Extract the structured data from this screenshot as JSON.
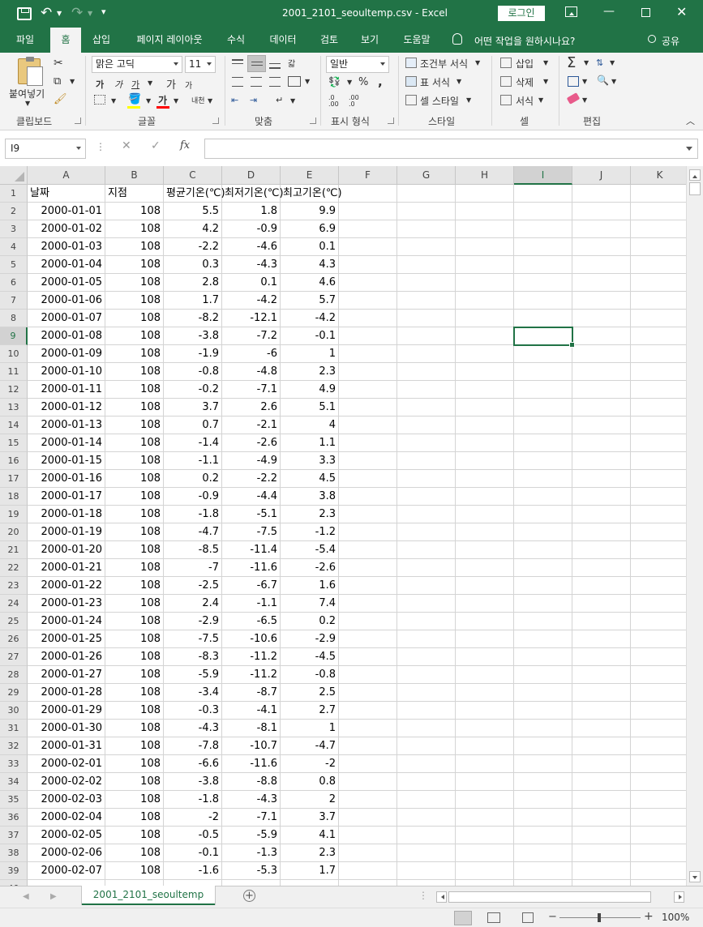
{
  "title_bar": {
    "document_title": "2001_2101_seoultemp.csv  -  Excel",
    "login_label": "로그인",
    "colors": {
      "brand": "#217346",
      "selection": "#217346"
    }
  },
  "quick_access": {
    "save_icon": "save-icon",
    "undo_icon": "undo-icon",
    "redo_icon": "redo-icon",
    "customize": "▾"
  },
  "tabs": [
    {
      "label": "파일"
    },
    {
      "label": "홈",
      "active": true
    },
    {
      "label": "삽입"
    },
    {
      "label": "페이지 레이아웃"
    },
    {
      "label": "수식"
    },
    {
      "label": "데이터"
    },
    {
      "label": "검토"
    },
    {
      "label": "보기"
    },
    {
      "label": "도움말"
    }
  ],
  "tell_me": "어떤 작업을 원하시나요?",
  "share": "공유",
  "ribbon": {
    "clipboard": {
      "paste_label": "붙여넣기",
      "group_label": "클립보드"
    },
    "font": {
      "font_name": "맑은 고딕",
      "font_size": "11",
      "group_label": "글꼴",
      "grow": "가",
      "shrink": "가",
      "bold": "가",
      "italic": "가",
      "underline": "가",
      "font_color_glyph": "가",
      "phonetic": "내천"
    },
    "alignment": {
      "group_label": "맞춤",
      "wrap": "갋"
    },
    "number": {
      "format": "일반",
      "group_label": "표시 형식",
      "percent": "%",
      "comma": ",",
      "inc_dec": ".0 .00",
      "dec_dec": ".00 .0"
    },
    "styles": {
      "conditional": "조건부 서식",
      "table": "표 서식",
      "cell_styles": "셀 스타일",
      "group_label": "스타일"
    },
    "cells": {
      "insert": "삽입",
      "delete": "삭제",
      "format": "서식",
      "group_label": "셀"
    },
    "editing": {
      "autosum": "Σ",
      "group_label": "편집"
    }
  },
  "formula_bar": {
    "name_box": "I9",
    "formula": "",
    "fx": "fx",
    "cancel": "✕",
    "enter": "✓"
  },
  "columns": [
    "A",
    "B",
    "C",
    "D",
    "E",
    "F",
    "G",
    "H",
    "I",
    "J",
    "K"
  ],
  "selected_cell": {
    "col": "I",
    "row": 9
  },
  "sheet": {
    "header": [
      "날짜",
      "지점",
      "평균기온(℃)",
      "최저기온(℃)",
      "최고기온(℃)"
    ],
    "rows": [
      [
        "2000-01-01",
        "108",
        "5.5",
        "1.8",
        "9.9"
      ],
      [
        "2000-01-02",
        "108",
        "4.2",
        "-0.9",
        "6.9"
      ],
      [
        "2000-01-03",
        "108",
        "-2.2",
        "-4.6",
        "0.1"
      ],
      [
        "2000-01-04",
        "108",
        "0.3",
        "-4.3",
        "4.3"
      ],
      [
        "2000-01-05",
        "108",
        "2.8",
        "0.1",
        "4.6"
      ],
      [
        "2000-01-06",
        "108",
        "1.7",
        "-4.2",
        "5.7"
      ],
      [
        "2000-01-07",
        "108",
        "-8.2",
        "-12.1",
        "-4.2"
      ],
      [
        "2000-01-08",
        "108",
        "-3.8",
        "-7.2",
        "-0.1"
      ],
      [
        "2000-01-09",
        "108",
        "-1.9",
        "-6",
        "1"
      ],
      [
        "2000-01-10",
        "108",
        "-0.8",
        "-4.8",
        "2.3"
      ],
      [
        "2000-01-11",
        "108",
        "-0.2",
        "-7.1",
        "4.9"
      ],
      [
        "2000-01-12",
        "108",
        "3.7",
        "2.6",
        "5.1"
      ],
      [
        "2000-01-13",
        "108",
        "0.7",
        "-2.1",
        "4"
      ],
      [
        "2000-01-14",
        "108",
        "-1.4",
        "-2.6",
        "1.1"
      ],
      [
        "2000-01-15",
        "108",
        "-1.1",
        "-4.9",
        "3.3"
      ],
      [
        "2000-01-16",
        "108",
        "0.2",
        "-2.2",
        "4.5"
      ],
      [
        "2000-01-17",
        "108",
        "-0.9",
        "-4.4",
        "3.8"
      ],
      [
        "2000-01-18",
        "108",
        "-1.8",
        "-5.1",
        "2.3"
      ],
      [
        "2000-01-19",
        "108",
        "-4.7",
        "-7.5",
        "-1.2"
      ],
      [
        "2000-01-20",
        "108",
        "-8.5",
        "-11.4",
        "-5.4"
      ],
      [
        "2000-01-21",
        "108",
        "-7",
        "-11.6",
        "-2.6"
      ],
      [
        "2000-01-22",
        "108",
        "-2.5",
        "-6.7",
        "1.6"
      ],
      [
        "2000-01-23",
        "108",
        "2.4",
        "-1.1",
        "7.4"
      ],
      [
        "2000-01-24",
        "108",
        "-2.9",
        "-6.5",
        "0.2"
      ],
      [
        "2000-01-25",
        "108",
        "-7.5",
        "-10.6",
        "-2.9"
      ],
      [
        "2000-01-26",
        "108",
        "-8.3",
        "-11.2",
        "-4.5"
      ],
      [
        "2000-01-27",
        "108",
        "-5.9",
        "-11.2",
        "-0.8"
      ],
      [
        "2000-01-28",
        "108",
        "-3.4",
        "-8.7",
        "2.5"
      ],
      [
        "2000-01-29",
        "108",
        "-0.3",
        "-4.1",
        "2.7"
      ],
      [
        "2000-01-30",
        "108",
        "-4.3",
        "-8.1",
        "1"
      ],
      [
        "2000-01-31",
        "108",
        "-7.8",
        "-10.7",
        "-4.7"
      ],
      [
        "2000-02-01",
        "108",
        "-6.6",
        "-11.6",
        "-2"
      ],
      [
        "2000-02-02",
        "108",
        "-3.8",
        "-8.8",
        "0.8"
      ],
      [
        "2000-02-03",
        "108",
        "-1.8",
        "-4.3",
        "2"
      ],
      [
        "2000-02-04",
        "108",
        "-2",
        "-7.1",
        "3.7"
      ],
      [
        "2000-02-05",
        "108",
        "-0.5",
        "-5.9",
        "4.1"
      ],
      [
        "2000-02-06",
        "108",
        "-0.1",
        "-1.3",
        "2.3"
      ],
      [
        "2000-02-07",
        "108",
        "-1.6",
        "-5.3",
        "1.7"
      ]
    ]
  },
  "sheet_tabs": [
    {
      "label": "2001_2101_seoultemp",
      "active": true
    }
  ],
  "status_bar": {
    "zoom": "100%",
    "zoom_minus": "−",
    "zoom_plus": "+"
  }
}
